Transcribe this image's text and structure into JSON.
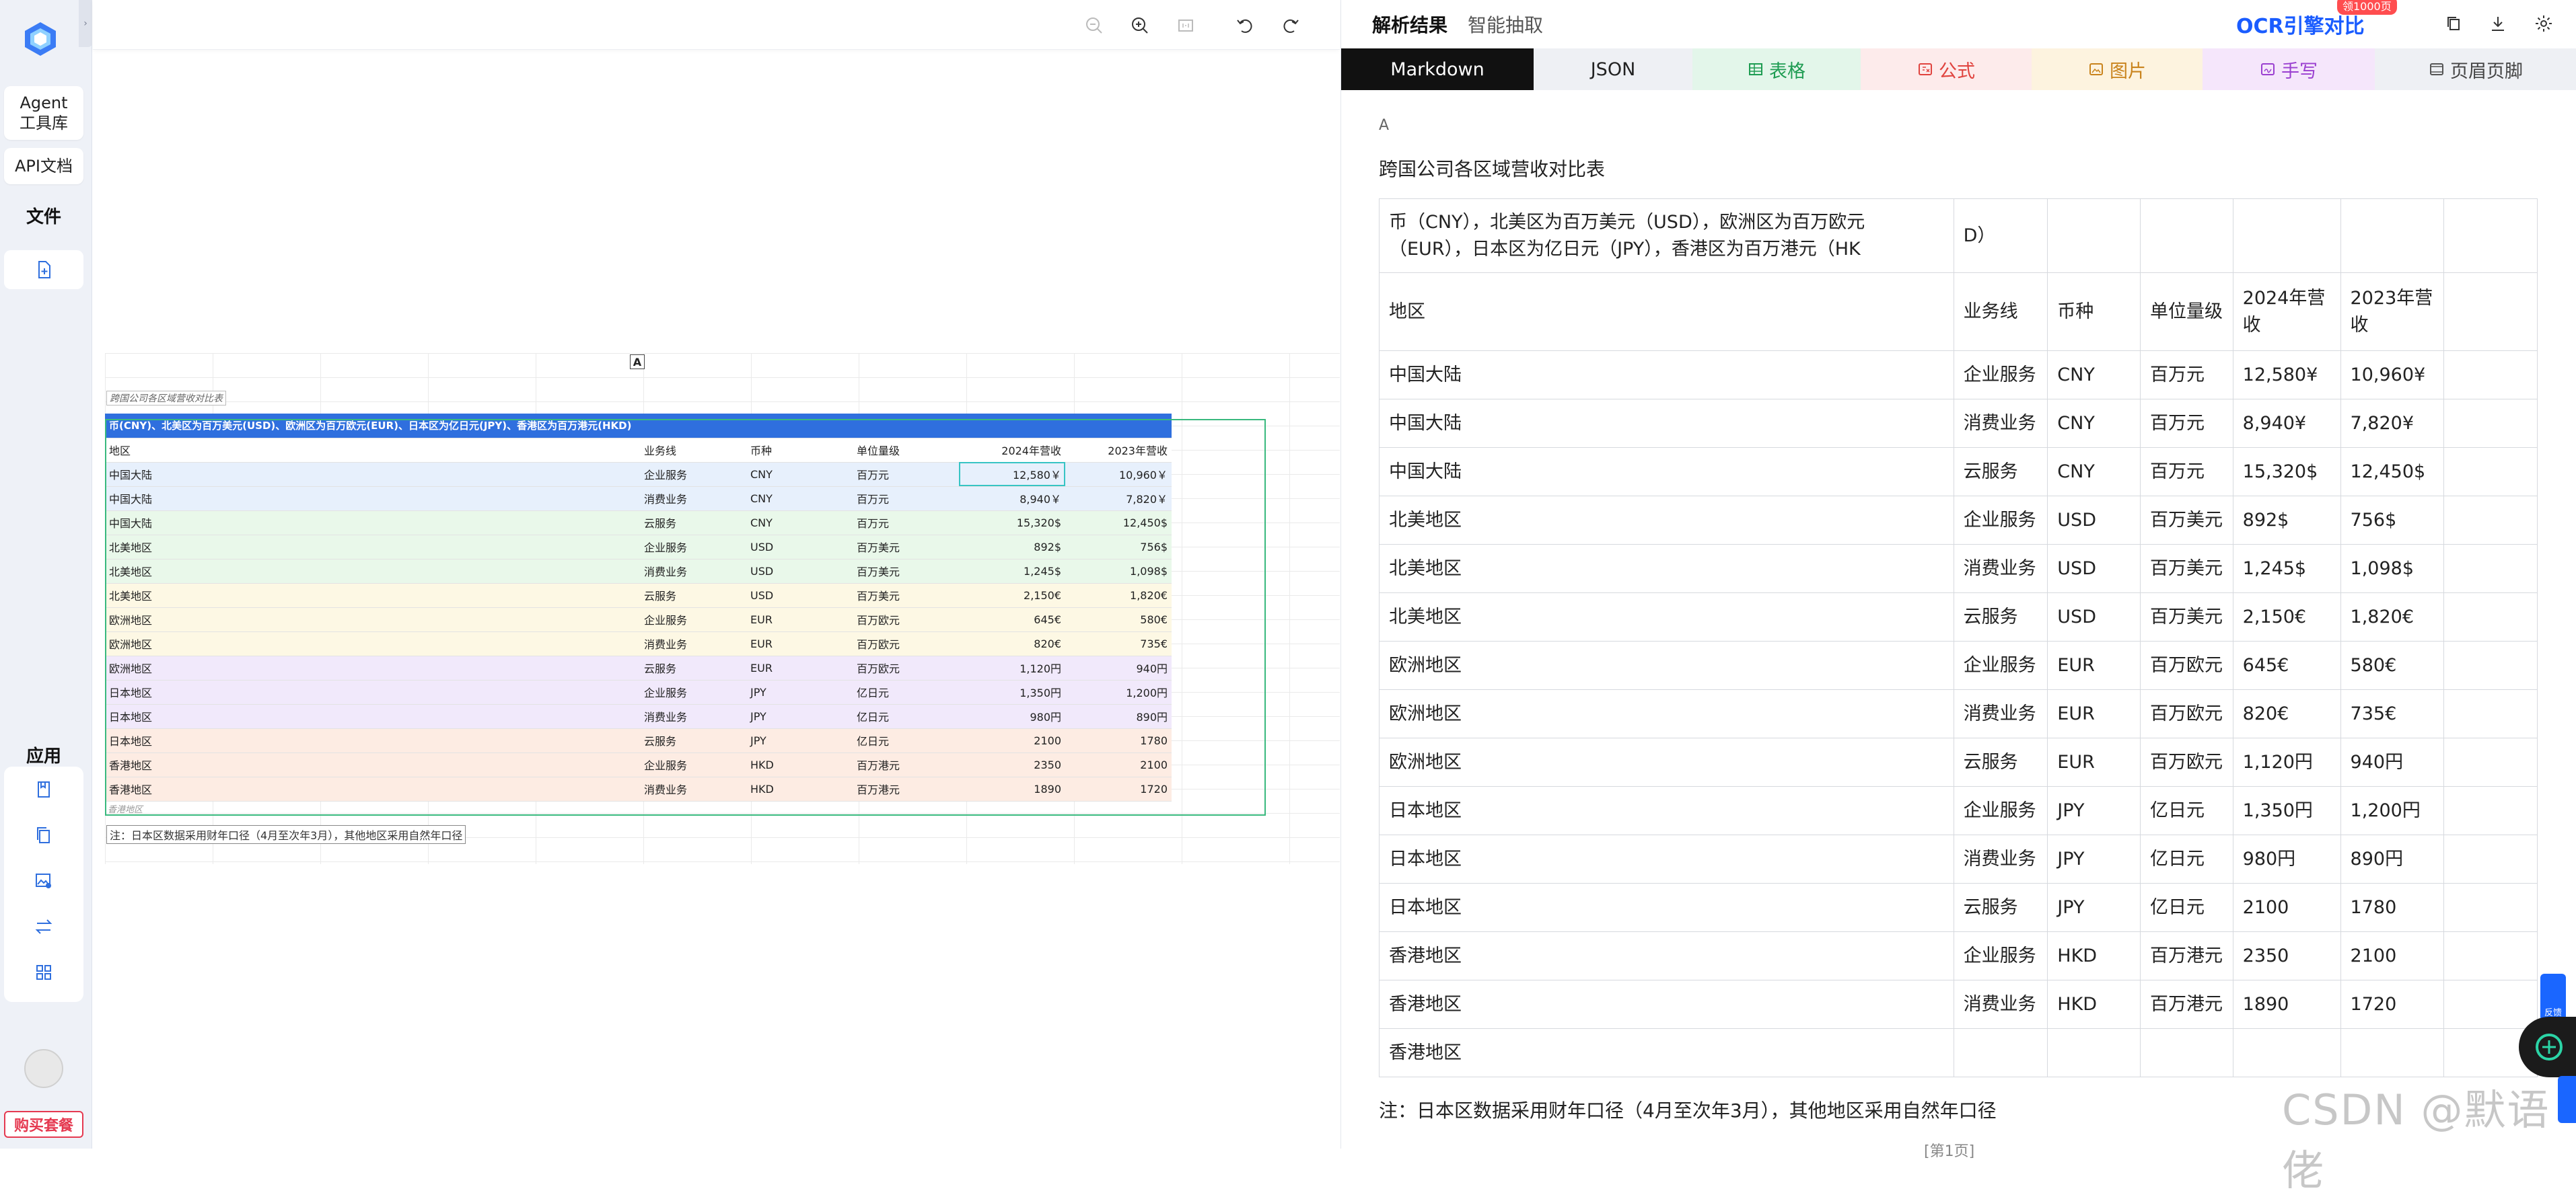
{
  "sidebar": {
    "agent_label": "Agent\n工具库",
    "api_label": "API文档",
    "files_title": "文件",
    "apps_title": "应用",
    "buy_label": "购买套餐"
  },
  "viewer": {
    "sheet_cell_a": "A",
    "caption": "跨国公司各区域营收对比表",
    "banner": "币(CNY)、北美区为百万美元(USD)、欧洲区为百万欧元(EUR)、日本区为亿日元(JPY)、香港区为百万港元(HKD)",
    "headers": [
      "地区",
      "业务线",
      "币种",
      "单位量级",
      "2024年营收",
      "2023年营收"
    ],
    "rows": [
      [
        "中国大陆",
        "企业服务",
        "CNY",
        "百万元",
        "12,580￥",
        "10,960￥"
      ],
      [
        "中国大陆",
        "消费业务",
        "CNY",
        "百万元",
        "8,940￥",
        "7,820￥"
      ],
      [
        "中国大陆",
        "云服务",
        "CNY",
        "百万元",
        "15,320$",
        "12,450$"
      ],
      [
        "北美地区",
        "企业服务",
        "USD",
        "百万美元",
        "892$",
        "756$"
      ],
      [
        "北美地区",
        "消费业务",
        "USD",
        "百万美元",
        "1,245$",
        "1,098$"
      ],
      [
        "北美地区",
        "云服务",
        "USD",
        "百万美元",
        "2,150€",
        "1,820€"
      ],
      [
        "欧洲地区",
        "企业服务",
        "EUR",
        "百万欧元",
        "645€",
        "580€"
      ],
      [
        "欧洲地区",
        "消费业务",
        "EUR",
        "百万欧元",
        "820€",
        "735€"
      ],
      [
        "欧洲地区",
        "云服务",
        "EUR",
        "百万欧元",
        "1,120円",
        "940円"
      ],
      [
        "日本地区",
        "企业服务",
        "JPY",
        "亿日元",
        "1,350円",
        "1,200円"
      ],
      [
        "日本地区",
        "消费业务",
        "JPY",
        "亿日元",
        "980円",
        "890円"
      ],
      [
        "日本地区",
        "云服务",
        "JPY",
        "亿日元",
        "2100",
        "1780"
      ],
      [
        "香港地区",
        "企业服务",
        "HKD",
        "百万港元",
        "2350",
        "2100"
      ],
      [
        "香港地区",
        "消费业务",
        "HKD",
        "百万港元",
        "1890",
        "1720"
      ]
    ],
    "stub": "香港地区",
    "note": "注：日本区数据采用财年口径（4月至次年3月），其他地区采用自然年口径"
  },
  "right": {
    "tab_results": "解析结果",
    "tab_extract": "智能抽取",
    "ocr_link": "OCR引擎对比",
    "ocr_badge": "领1000页",
    "format_tabs": [
      "Markdown",
      "JSON",
      "表格",
      "公式",
      "图片",
      "手写",
      "页眉页脚"
    ],
    "md_a": "A",
    "md_title": "跨国公司各区域营收对比表",
    "table_top": [
      "币（CNY），北美区为百万美元（USD），欧洲区为百万欧元（EUR），日本区为亿日元（JPY），香港区为百万港元（HK",
      "D）",
      "",
      "",
      "",
      "",
      ""
    ],
    "table_headers": [
      "地区",
      "业务线",
      "币种",
      "单位量级",
      "2024年营收",
      "2023年营收",
      ""
    ],
    "table_rows": [
      [
        "中国大陆",
        "企业服务",
        "CNY",
        "百万元",
        "12,580¥",
        "10,960¥",
        ""
      ],
      [
        "中国大陆",
        "消费业务",
        "CNY",
        "百万元",
        "8,940¥",
        "7,820¥",
        ""
      ],
      [
        "中国大陆",
        "云服务",
        "CNY",
        "百万元",
        "15,320$",
        "12,450$",
        ""
      ],
      [
        "北美地区",
        "企业服务",
        "USD",
        "百万美元",
        "892$",
        "756$",
        ""
      ],
      [
        "北美地区",
        "消费业务",
        "USD",
        "百万美元",
        "1,245$",
        "1,098$",
        ""
      ],
      [
        "北美地区",
        "云服务",
        "USD",
        "百万美元",
        "2,150€",
        "1,820€",
        ""
      ],
      [
        "欧洲地区",
        "企业服务",
        "EUR",
        "百万欧元",
        "645€",
        "580€",
        ""
      ],
      [
        "欧洲地区",
        "消费业务",
        "EUR",
        "百万欧元",
        "820€",
        "735€",
        ""
      ],
      [
        "欧洲地区",
        "云服务",
        "EUR",
        "百万欧元",
        "1,120円",
        "940円",
        ""
      ],
      [
        "日本地区",
        "企业服务",
        "JPY",
        "亿日元",
        "1,350円",
        "1,200円",
        ""
      ],
      [
        "日本地区",
        "消费业务",
        "JPY",
        "亿日元",
        "980円",
        "890円",
        ""
      ],
      [
        "日本地区",
        "云服务",
        "JPY",
        "亿日元",
        "2100",
        "1780",
        ""
      ],
      [
        "香港地区",
        "企业服务",
        "HKD",
        "百万港元",
        "2350",
        "2100",
        ""
      ],
      [
        "香港地区",
        "消费业务",
        "HKD",
        "百万港元",
        "1890",
        "1720",
        ""
      ],
      [
        "香港地区",
        "",
        "",
        "",
        "",
        "",
        ""
      ]
    ],
    "md_note": "注：日本区数据采用财年口径（4月至次年3月），其他地区采用自然年口径",
    "md_page": "[第1页]",
    "watermark": "CSDN @默语佬",
    "feedback": "反馈"
  },
  "colors": {
    "accent": "#1a5cff",
    "active_tab_bg": "#111111",
    "banner_blue": "#2f6fde",
    "buy_red": "#e53950"
  }
}
